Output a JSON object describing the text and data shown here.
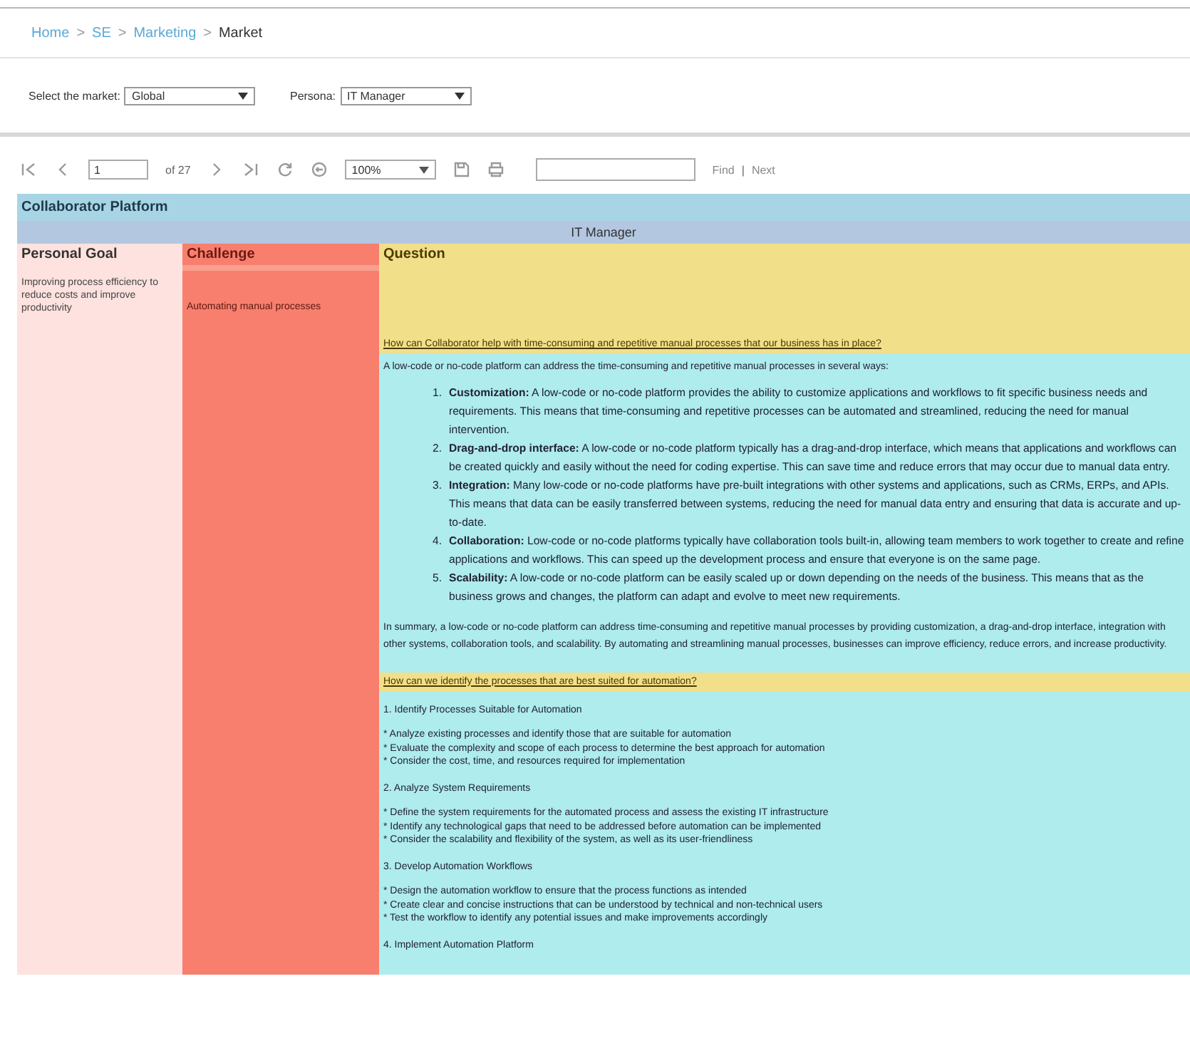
{
  "breadcrumb": {
    "separator": ">",
    "items": [
      {
        "label": "Home",
        "link": true
      },
      {
        "label": "SE",
        "link": true
      },
      {
        "label": "Marketing",
        "link": true
      },
      {
        "label": "Market",
        "link": false
      }
    ]
  },
  "filters": [
    {
      "label": "Select the market:",
      "value": "Global"
    },
    {
      "label": "Persona:",
      "value": "IT Manager"
    }
  ],
  "toolbar": {
    "page": "1",
    "page_count": "of 27",
    "zoom": "100%",
    "find": "Find",
    "divider": "|",
    "next": "Next"
  },
  "report": {
    "title": "Collaborator Platform",
    "persona": "IT Manager",
    "columns": [
      "Personal Goal",
      "Challenge",
      "Question"
    ],
    "goal": "Improving process efficiency to reduce costs and improve productivity",
    "challenge": "Automating manual processes",
    "qa": [
      {
        "question": "How can Collaborator help with time-consuming and repetitive manual processes that our business has in place?",
        "answer": [
          {
            "kind": "paragraph",
            "text": "A low-code or no-code platform can address the time-consuming and repetitive manual processes in several ways:"
          },
          {
            "kind": "list",
            "items": [
              {
                "marker": "1.",
                "term": "Customization:",
                "text": "A low-code or no-code platform provides the ability to customize applications and workflows to fit specific business needs and requirements. This means that time-consuming and repetitive processes can be automated and streamlined, reducing the need for manual intervention."
              },
              {
                "marker": "2.",
                "term": "Drag-and-drop interface:",
                "text": "A low-code or no-code platform typically has a drag-and-drop interface, which means that applications and workflows can be created quickly and easily without the need for coding expertise. This can save time and reduce errors that may occur due to manual data entry."
              },
              {
                "marker": "3.",
                "term": "Integration:",
                "text": "Many low-code or no-code platforms have pre-built integrations with other systems and applications, such as CRMs, ERPs, and APIs. This means that data can be easily transferred between systems, reducing the need for manual data entry and ensuring that data is accurate and up-to-date."
              },
              {
                "marker": "4.",
                "term": "Collaboration:",
                "text": "Low-code or no-code platforms typically have collaboration tools built-in, allowing team members to work together to create and refine applications and workflows. This can speed up the development process and ensure that everyone is on the same page."
              },
              {
                "marker": "5.",
                "term": "Scalability:",
                "text": "A low-code or no-code platform can be easily scaled up or down depending on the needs of the business. This means that as the business grows and changes, the platform can adapt and evolve to meet new requirements."
              }
            ]
          },
          {
            "kind": "paragraph",
            "text": "In summary, a low-code or no-code platform can address time-consuming and repetitive manual processes by providing customization, a drag-and-drop interface, integration with other systems, collaboration tools, and scalability. By automating and streamlining manual processes, businesses can improve efficiency, reduce errors, and increase productivity."
          }
        ]
      },
      {
        "question": "How can we identify the processes that are best suited for automation?",
        "answer": [
          {
            "kind": "heading",
            "text": "1. Identify Processes Suitable for Automation"
          },
          {
            "kind": "bullets",
            "lines": [
              "* Analyze existing processes and identify those that are suitable for automation",
              "* Evaluate the complexity and scope of each process to determine the best approach for automation",
              "* Consider the cost, time, and resources required for implementation"
            ]
          },
          {
            "kind": "heading",
            "text": "2. Analyze System Requirements"
          },
          {
            "kind": "bullets",
            "lines": [
              "* Define the system requirements for the automated process and assess the existing IT infrastructure",
              "* Identify any technological gaps that need to be addressed before automation can be implemented",
              "* Consider the scalability and flexibility of the system, as well as its user-friendliness"
            ]
          },
          {
            "kind": "heading",
            "text": "3. Develop Automation Workflows"
          },
          {
            "kind": "bullets",
            "lines": [
              "* Design the automation workflow to ensure that the process functions as intended",
              "* Create clear and concise instructions that can be understood by technical and non-technical users",
              "* Test the workflow to identify any potential issues and make improvements accordingly"
            ]
          },
          {
            "kind": "heading",
            "text": "4. Implement Automation Platform"
          }
        ]
      }
    ]
  }
}
